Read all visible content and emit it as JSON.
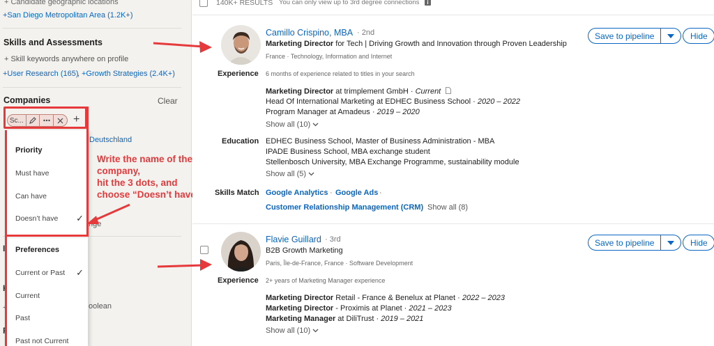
{
  "left_panel": {
    "geo_helper": "Candidate geographic locations",
    "geo_chip": "+San Diego Metropolitan Area (1.2K+)",
    "skills_title": "Skills and Assessments",
    "skills_helper": "Skill keywords anywhere on profile",
    "skills_chip_1": "+User Research (165)",
    "skills_chip_sep": ",",
    "skills_chip_2": "+Growth Strategies (2.4K+)",
    "companies_title": "Companies",
    "clear_label": "Clear",
    "company_pill_text": "Sc...",
    "company_behind_text": "Deutschland",
    "behind_nge": "nge",
    "behind_oolean": "oolean",
    "behind_i": "I",
    "behind_k": "K",
    "behind_p": "P",
    "behind_plus": "+",
    "plus_label": "+"
  },
  "menu": {
    "priority_head": "Priority",
    "priority_items": [
      "Must have",
      "Can have",
      "Doesn’t have"
    ],
    "preferences_head": "Preferences",
    "preference_items": [
      "Current or Past",
      "Current",
      "Past",
      "Past not Current"
    ],
    "checkmark": "✓"
  },
  "annotation": {
    "text": "Write the name of the company,\nhit the 3 dots, and\nchoose “Doesn’t have”"
  },
  "topbar": {
    "results": "140K+ RESULTS",
    "note": "You can only view up to 3rd degree connections",
    "info": "i"
  },
  "buttons": {
    "save_to_pipeline": "Save to pipeline",
    "hide": "Hide"
  },
  "labels": {
    "experience": "Experience",
    "education": "Education",
    "skills_match": "Skills Match",
    "show_all_exp": "Show all (10)",
    "show_all_edu": "Show all (5)",
    "show_all_skills": "Show all (8)"
  },
  "candidate1": {
    "name": "Camillo Crispino, MBA",
    "degree": "· 2nd",
    "headline_bold": "Marketing Director",
    "headline_rest": " for Tech | Driving Growth and Innovation through Proven Leadership",
    "location": "France · Technology, Information and Internet",
    "experience_summary": "6 months of experience related to titles in your search",
    "exp1_title": "Marketing Director",
    "exp1_rest": " at trimplement GmbH · ",
    "exp1_current": "Current",
    "exp2_text": "Head Of International Marketing at EDHEC Business School · ",
    "exp2_dates": "2020 – 2022",
    "exp3_text": "Program Manager at Amadeus · ",
    "exp3_dates": "2019 – 2020",
    "edu1": "EDHEC Business School, Master of Business Administration - MBA",
    "edu2": "IPADE Business School, MBA exchange student",
    "edu3": "Stellenbosch University, MBA Exchange Programme, sustainability module",
    "skill1": "Google Analytics",
    "skill2": "Google Ads",
    "skill3": "Customer Relationship Management (CRM)",
    "dot": "·"
  },
  "candidate2": {
    "name": "Flavie Guillard",
    "degree": "· 3rd",
    "headline": "B2B Growth Marketing",
    "location": "Paris, Île-de-France, France · Software Development",
    "experience_summary": "2+ years of Marketing Manager experience",
    "exp1_title": "Marketing Director",
    "exp1_rest": " Retail - France & Benelux at Planet · ",
    "exp1_dates": "2022 – 2023",
    "exp2_title": "Marketing Director",
    "exp2_rest": " - Proximis at Planet · ",
    "exp2_dates": "2021 – 2023",
    "exp3_title": "Marketing Manager",
    "exp3_rest": " at DiliTrust · ",
    "exp3_dates": "2019 – 2021"
  },
  "colors": {
    "accent": "#0a66c2",
    "annotation": "#e5393b"
  }
}
